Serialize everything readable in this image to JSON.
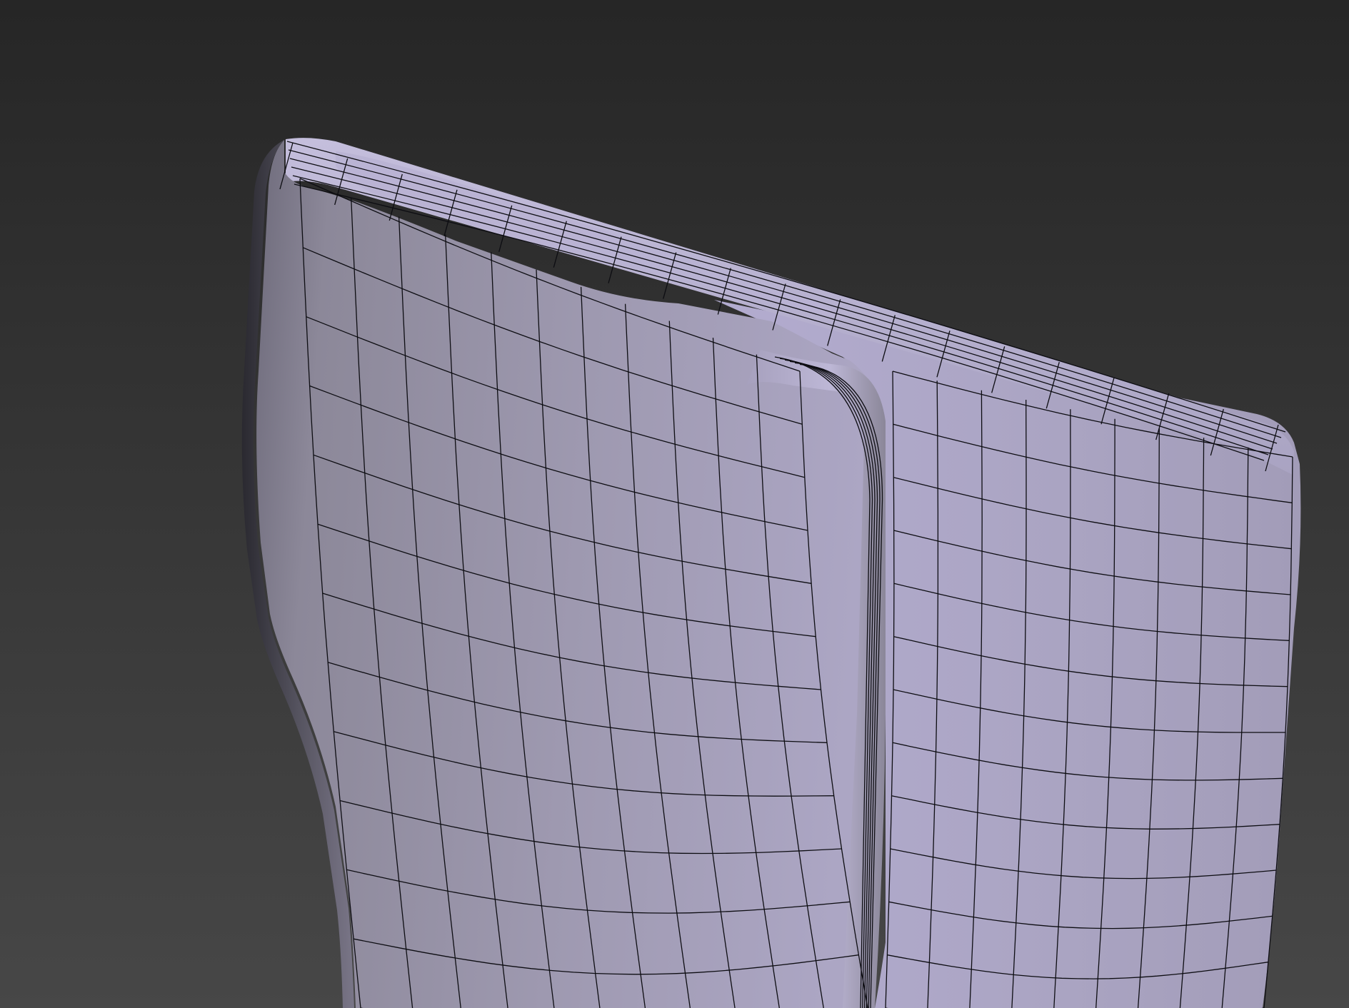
{
  "viewport": {
    "shading_mode": "edged-faces",
    "background_top": "#262626",
    "background_bottom": "#474747",
    "object": {
      "name": "subdivided-mesh",
      "base_color": "#a7a1bc",
      "highlight_color": "#bdb7d6",
      "shadow_color": "#7c788a",
      "wire_color": "#0d0d12"
    }
  }
}
